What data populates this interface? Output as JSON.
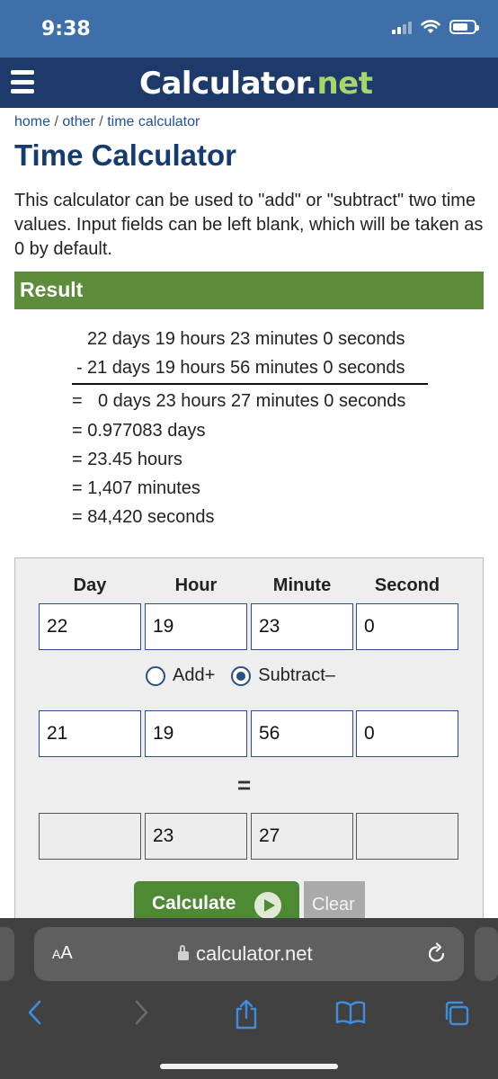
{
  "status_bar": {
    "time": "9:38"
  },
  "header": {
    "logo_main": "Calculator.",
    "logo_tld": "net"
  },
  "breadcrumb": {
    "home": "home",
    "sep": " / ",
    "other": "other",
    "current": "time calculator"
  },
  "page": {
    "title": "Time Calculator",
    "description": "This calculator can be used to \"add\" or \"subtract\" two time values. Input fields can be left blank, which will be taken as 0 by default."
  },
  "result": {
    "heading": "Result",
    "line1": "22 days 19 hours 23 minutes 0 seconds",
    "line2_op": "-",
    "line2": "21 days 19 hours 56 minutes 0 seconds",
    "line3_eq": "=",
    "line3": "0 days 23 hours 27 minutes 0 seconds",
    "conversions": [
      "= 0.977083 days",
      "= 23.45 hours",
      "= 1,407 minutes",
      "= 84,420 seconds"
    ]
  },
  "calculator": {
    "columns": [
      "Day",
      "Hour",
      "Minute",
      "Second"
    ],
    "row1": [
      "22",
      "19",
      "23",
      "0"
    ],
    "row2": [
      "21",
      "19",
      "56",
      "0"
    ],
    "row3": [
      "",
      "23",
      "27",
      ""
    ],
    "add_label": "Add+",
    "subtract_label": "Subtract–",
    "selected_operation": "subtract",
    "equals": "=",
    "calculate_label": "Calculate",
    "clear_label": "Clear"
  },
  "browser": {
    "text_size": "AA",
    "url": "calculator.net"
  },
  "colors": {
    "status_bar": "#3f6fa8",
    "header": "#1d3a6b",
    "accent_green": "#5d8c3a",
    "title_blue": "#163b70",
    "link_blue": "#1f5296"
  }
}
